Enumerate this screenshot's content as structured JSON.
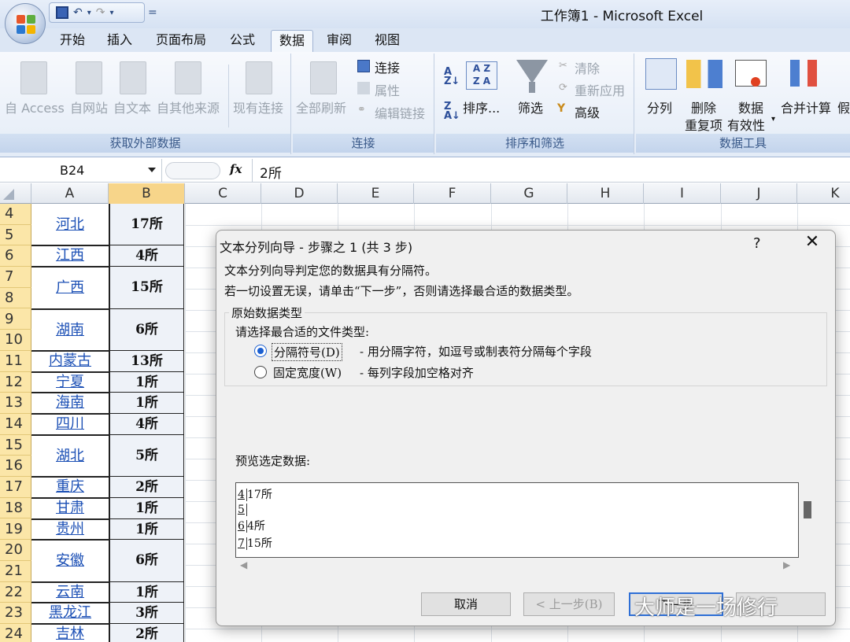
{
  "window": {
    "title": "工作簿1 - Microsoft Excel"
  },
  "quick_access": {
    "save_icon": "save-icon",
    "undo_icon": "undo-icon",
    "redo_icon": "redo-icon"
  },
  "tabs": [
    "开始",
    "插入",
    "页面布局",
    "公式",
    "数据",
    "审阅",
    "视图"
  ],
  "active_tab": "数据",
  "ribbon": {
    "get_external": {
      "label": "获取外部数据",
      "buttons": [
        "自 Access",
        "自网站",
        "自文本",
        "自其他来源",
        "现有连接"
      ]
    },
    "connections": {
      "label": "连接",
      "refresh_all": "全部刷新",
      "items": [
        "连接",
        "属性",
        "编辑链接"
      ]
    },
    "sort_filter": {
      "label": "排序和筛选",
      "sort": "排序...",
      "filter": "筛选",
      "clear": "清除",
      "reapply": "重新应用",
      "advanced": "高级"
    },
    "data_tools": {
      "label": "数据工具",
      "split": "分列",
      "remove_dup_1": "删除",
      "remove_dup_2": "重复项",
      "validation_1": "数据",
      "validation_2": "有效性",
      "consolidate": "合并计算",
      "whatif": "假"
    }
  },
  "formula_bar": {
    "name_box": "B24",
    "fx": "fx",
    "value": "2所"
  },
  "columns": [
    "A",
    "B",
    "C",
    "D",
    "E",
    "F",
    "G",
    "H",
    "I",
    "J",
    "K"
  ],
  "rows": [
    {
      "nums": [
        "4",
        "5"
      ],
      "a": "河北",
      "b": "17所"
    },
    {
      "nums": [
        "6"
      ],
      "a": "江西",
      "b": "4所"
    },
    {
      "nums": [
        "7",
        "8"
      ],
      "a": "广西",
      "b": "15所"
    },
    {
      "nums": [
        "9",
        "10"
      ],
      "a": "湖南",
      "b": "6所"
    },
    {
      "nums": [
        "11"
      ],
      "a": "内蒙古",
      "b": "13所"
    },
    {
      "nums": [
        "12"
      ],
      "a": "宁夏",
      "b": "1所"
    },
    {
      "nums": [
        "13"
      ],
      "a": "海南",
      "b": "1所"
    },
    {
      "nums": [
        "14"
      ],
      "a": "四川",
      "b": "4所"
    },
    {
      "nums": [
        "15",
        "16"
      ],
      "a": "湖北",
      "b": "5所"
    },
    {
      "nums": [
        "17"
      ],
      "a": "重庆",
      "b": "2所"
    },
    {
      "nums": [
        "18"
      ],
      "a": "甘肃",
      "b": "1所"
    },
    {
      "nums": [
        "19"
      ],
      "a": "贵州",
      "b": "1所"
    },
    {
      "nums": [
        "20",
        "21"
      ],
      "a": "安徽",
      "b": "6所"
    },
    {
      "nums": [
        "22"
      ],
      "a": "云南",
      "b": "1所"
    },
    {
      "nums": [
        "23"
      ],
      "a": "黑龙江",
      "b": "3所"
    },
    {
      "nums": [
        "24"
      ],
      "a": "吉林",
      "b": "2所"
    }
  ],
  "dialog": {
    "title": "文本分列向导 - 步骤之 1 (共 3 步)",
    "help": "?",
    "close": "✕",
    "line1": "文本分列向导判定您的数据具有分隔符。",
    "line2": "若一切设置无误，请单击“下一步”，否则请选择最合适的数据类型。",
    "group_title": "原始数据类型",
    "choose_label": "请选择最合适的文件类型:",
    "option1_label": "分隔符号(D)",
    "option1_desc": "- 用分隔字符，如逗号或制表符分隔每个字段",
    "option2_label": "固定宽度(W)",
    "option2_desc": "- 每列字段加空格对齐",
    "selected_option": "分隔符号(D)",
    "preview_label": "预览选定数据:",
    "preview_rows": [
      {
        "n": "4",
        "text": "17所"
      },
      {
        "n": "5",
        "text": ""
      },
      {
        "n": "6",
        "text": "4所"
      },
      {
        "n": "7",
        "text": "15所"
      }
    ],
    "cancel": "取消",
    "back": "< 上一步(B)",
    "next": "下一步"
  },
  "watermark": "大师是一场修行"
}
